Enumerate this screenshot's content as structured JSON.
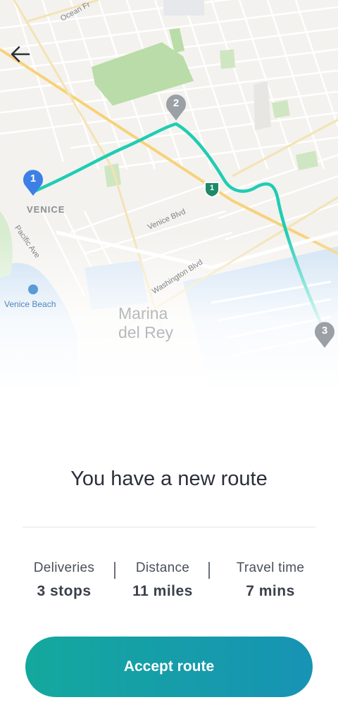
{
  "map": {
    "labels": {
      "venice": "VENICE",
      "pacific_ave": "Pacific Ave",
      "venice_blvd": "Venice Blvd",
      "washington_blvd": "Washington Blvd",
      "ocean_front": "Ocean Fr",
      "venice_beach": "Venice Beach",
      "marina_del_rey_line1": "Marina",
      "marina_del_rey_line2": "del Rey"
    },
    "stops": [
      {
        "number": "1",
        "color": "#3d7fe6"
      },
      {
        "number": "2",
        "color": "#9ba0a6"
      },
      {
        "number": "3",
        "color": "#9ba0a6"
      }
    ],
    "highway_shield": "1",
    "route_color": "#1fcdb3"
  },
  "nav": {
    "back_icon": "arrow-left-icon"
  },
  "summary": {
    "title": "You have a new route",
    "stats": [
      {
        "label": "Deliveries",
        "value": "3 stops"
      },
      {
        "label": "Distance",
        "value": "11 miles"
      },
      {
        "label": "Travel time",
        "value": "7 mins"
      }
    ]
  },
  "actions": {
    "accept_label": "Accept route",
    "accent_gradient": [
      "#14a89d",
      "#1793b4"
    ]
  }
}
